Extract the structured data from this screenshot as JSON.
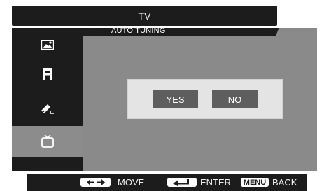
{
  "header": {
    "title": "TV"
  },
  "sidebar": {
    "items": [
      {
        "icon": "picture-icon"
      },
      {
        "icon": "sound-icon"
      },
      {
        "icon": "settings-icon"
      },
      {
        "icon": "tv-icon",
        "active": true
      }
    ]
  },
  "content": {
    "section_title": "AUTO TUNING",
    "dialog": {
      "yes_label": "YES",
      "no_label": "NO"
    }
  },
  "footer": {
    "move_label": "MOVE",
    "enter_label": "ENTER",
    "menu_key": "MENU",
    "back_label": "BACK"
  },
  "colors": {
    "panel_dark": "#1c1c1c",
    "content_gray": "#8a8a8a",
    "sidebar_active": "#8c8c8c",
    "dialog_bg": "#e4e4e4",
    "button_bg": "#5e5e5e"
  }
}
